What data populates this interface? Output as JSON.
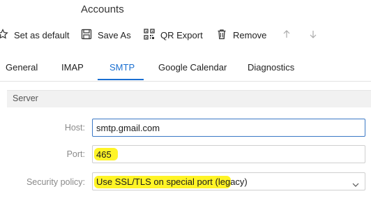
{
  "window": {
    "title": "Accounts"
  },
  "toolbar": {
    "set_default": "Set as default",
    "save_as": "Save As",
    "qr_export": "QR Export",
    "remove": "Remove"
  },
  "tabs": [
    {
      "label": "General"
    },
    {
      "label": "IMAP"
    },
    {
      "label": "SMTP",
      "active": true
    },
    {
      "label": "Google Calendar"
    },
    {
      "label": "Diagnostics"
    }
  ],
  "server": {
    "section_title": "Server",
    "host_label": "Host:",
    "host_value": "smtp.gmail.com",
    "port_label": "Port:",
    "port_value": "465",
    "security_label": "Security policy:",
    "security_value": "Use SSL/TLS on special port (legacy)"
  },
  "colors": {
    "accent": "#1a6fd1",
    "highlight": "#fff200"
  }
}
